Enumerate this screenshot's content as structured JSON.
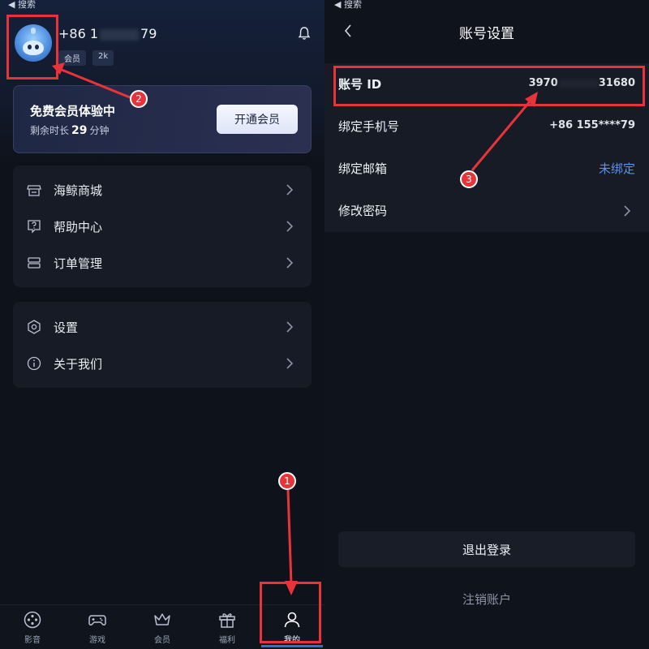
{
  "left_screen": {
    "status_back": "◀ 搜索",
    "profile": {
      "phone_prefix": "+86 1",
      "phone_suffix": "79",
      "badges": [
        "会员",
        "2k"
      ]
    },
    "vip_card": {
      "title": "免费会员体验中",
      "remaining_label": "剩余时长",
      "remaining_value": "29",
      "remaining_unit": "分钟",
      "button_label": "开通会员"
    },
    "menu_group_1": [
      {
        "label": "海鲸商城",
        "icon": "store-icon"
      },
      {
        "label": "帮助中心",
        "icon": "help-icon"
      },
      {
        "label": "订单管理",
        "icon": "order-icon"
      }
    ],
    "menu_group_2": [
      {
        "label": "设置",
        "icon": "settings-icon"
      },
      {
        "label": "关于我们",
        "icon": "info-icon"
      }
    ],
    "bottom_nav": [
      {
        "label": "影音",
        "icon": "media-icon"
      },
      {
        "label": "游戏",
        "icon": "gamepad-icon"
      },
      {
        "label": "会员",
        "icon": "crown-icon"
      },
      {
        "label": "福利",
        "icon": "gift-icon"
      },
      {
        "label": "我的",
        "icon": "user-icon",
        "active": true
      }
    ]
  },
  "right_screen": {
    "status_back": "◀ 搜索",
    "title": "账号设置",
    "rows": [
      {
        "label": "账号 ID",
        "value_prefix": "3970",
        "value_suffix": "31680"
      },
      {
        "label": "绑定手机号",
        "value": "+86 155****79"
      },
      {
        "label": "绑定邮箱",
        "value": "未绑定"
      },
      {
        "label": "修改密码"
      }
    ],
    "logout_label": "退出登录",
    "cancel_account_label": "注销账户"
  },
  "annotations": [
    "1",
    "2",
    "3"
  ],
  "colors": {
    "accent_blue": "#5b8ff0",
    "annotation_red": "#e8333a",
    "background": "#0e121b"
  }
}
